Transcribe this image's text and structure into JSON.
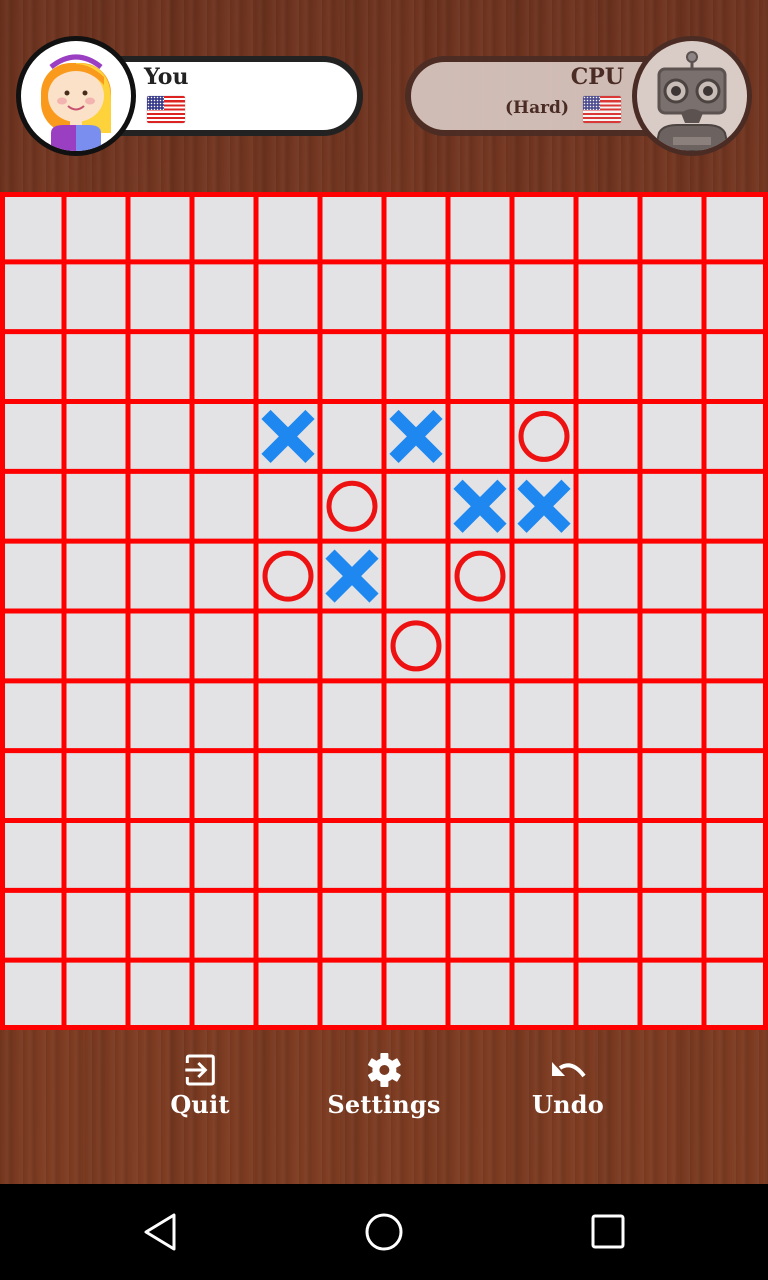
{
  "players": {
    "you": {
      "name": "You",
      "flag": "us-flag-icon",
      "avatar": "girl-avatar"
    },
    "cpu": {
      "name": "CPU",
      "level": "(Hard)",
      "flag": "us-flag-icon",
      "avatar": "robot-avatar"
    }
  },
  "board": {
    "columns": 12,
    "rows": 12,
    "colors": {
      "grid": "#ff0000",
      "cell": "#e3e3e5",
      "x": "#1e88f0",
      "o": "#ee1111"
    },
    "pieces": [
      {
        "row": 3,
        "col": 4,
        "mark": "X"
      },
      {
        "row": 3,
        "col": 6,
        "mark": "X"
      },
      {
        "row": 3,
        "col": 8,
        "mark": "O"
      },
      {
        "row": 4,
        "col": 5,
        "mark": "O"
      },
      {
        "row": 4,
        "col": 7,
        "mark": "X"
      },
      {
        "row": 4,
        "col": 8,
        "mark": "X"
      },
      {
        "row": 5,
        "col": 4,
        "mark": "O"
      },
      {
        "row": 5,
        "col": 5,
        "mark": "X"
      },
      {
        "row": 5,
        "col": 7,
        "mark": "O"
      },
      {
        "row": 6,
        "col": 6,
        "mark": "O"
      }
    ]
  },
  "toolbar": {
    "quit_label": "Quit",
    "settings_label": "Settings",
    "undo_label": "Undo"
  },
  "navbar": {
    "back": "back-icon",
    "home": "home-icon",
    "recent": "recent-apps-icon"
  }
}
